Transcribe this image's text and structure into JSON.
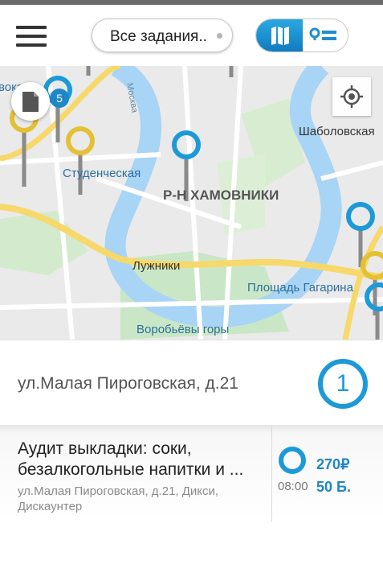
{
  "toolbar": {
    "filter_label": "Все задания..",
    "menu_icon": "hamburger-menu-icon",
    "map_view_icon": "map-icon",
    "list_view_icon": "list-icon"
  },
  "map": {
    "badge_count": "5",
    "labels": {
      "vokzal": "вокзал",
      "moskva": "Москва",
      "shabolovskaya": "Шаболовская",
      "studencheskaya": "Студенческая",
      "khamovniki": "Р-Н ХАМОВНИКИ",
      "luzhniki": "Лужники",
      "ploshchad_gagarina": "Площадь Гагарина",
      "vorobyovy_gory": "Воробьёвы горы"
    }
  },
  "address": {
    "text": "ул.Малая Пироговская, д.21",
    "task_count": "1"
  },
  "task": {
    "title": "Аудит выкладки: соки, безалкогольные напитки и ...",
    "subtitle": "ул.Малая Пироговская, д.21, Дикси, Дискаунтер",
    "price": "270₽",
    "time": "08:00",
    "points": "50 Б."
  },
  "colors": {
    "accent_blue": "#1c9ad8",
    "pin_yellow": "#e4c035",
    "river": "#a8d4f5",
    "park": "#c9e7c6",
    "road_yellow": "#f7d86a"
  }
}
